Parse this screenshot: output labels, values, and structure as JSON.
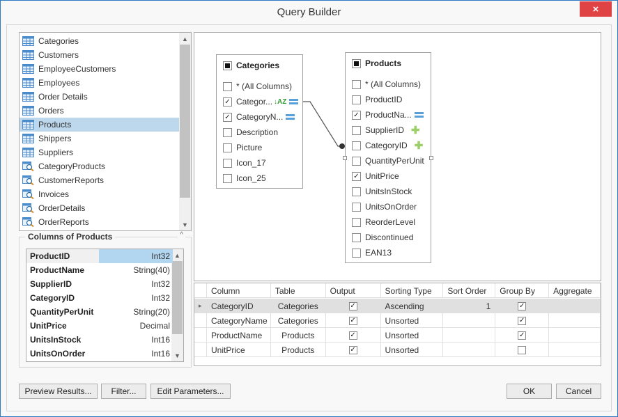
{
  "window": {
    "title": "Query Builder",
    "close_icon": "×"
  },
  "tables_list": {
    "items": [
      {
        "label": "Categories",
        "kind": "table"
      },
      {
        "label": "Customers",
        "kind": "table"
      },
      {
        "label": "EmployeeCustomers",
        "kind": "table"
      },
      {
        "label": "Employees",
        "kind": "table"
      },
      {
        "label": "Order Details",
        "kind": "table"
      },
      {
        "label": "Orders",
        "kind": "table"
      },
      {
        "label": "Products",
        "kind": "table",
        "selected": true
      },
      {
        "label": "Shippers",
        "kind": "table"
      },
      {
        "label": "Suppliers",
        "kind": "table"
      },
      {
        "label": "CategoryProducts",
        "kind": "view"
      },
      {
        "label": "CustomerReports",
        "kind": "view"
      },
      {
        "label": "Invoices",
        "kind": "view"
      },
      {
        "label": "OrderDetails",
        "kind": "view"
      },
      {
        "label": "OrderReports",
        "kind": "view"
      }
    ],
    "scroll_up_icon": "▲",
    "scroll_down_icon": "▼"
  },
  "columns_group": {
    "title": "Columns of Products",
    "collapse_icon": "^",
    "rows": [
      {
        "name": "ProductID",
        "type": "Int32"
      },
      {
        "name": "ProductName",
        "type": "String(40)"
      },
      {
        "name": "SupplierID",
        "type": "Int32"
      },
      {
        "name": "CategoryID",
        "type": "Int32"
      },
      {
        "name": "QuantityPerUnit",
        "type": "String(20)"
      },
      {
        "name": "UnitPrice",
        "type": "Decimal"
      },
      {
        "name": "UnitsInStock",
        "type": "Int16"
      },
      {
        "name": "UnitsOnOrder",
        "type": "Int16"
      }
    ]
  },
  "diagram": {
    "categories": {
      "title": "Categories",
      "columns": [
        {
          "label": "* (All Columns)",
          "checked": false
        },
        {
          "label": "Categor...",
          "checked": true,
          "icons": [
            "sort-az",
            "group"
          ]
        },
        {
          "label": "CategoryN...",
          "checked": true,
          "icons": [
            "group"
          ]
        },
        {
          "label": "Description",
          "checked": false
        },
        {
          "label": "Picture",
          "checked": false
        },
        {
          "label": "Icon_17",
          "checked": false
        },
        {
          "label": "Icon_25",
          "checked": false
        }
      ]
    },
    "products": {
      "title": "Products",
      "columns": [
        {
          "label": "* (All Columns)",
          "checked": false
        },
        {
          "label": "ProductID",
          "checked": false
        },
        {
          "label": "ProductNa...",
          "checked": true,
          "icons": [
            "group"
          ]
        },
        {
          "label": "SupplierID",
          "checked": false,
          "icons": [
            "plus"
          ]
        },
        {
          "label": "CategoryID",
          "checked": false,
          "icons": [
            "plus"
          ]
        },
        {
          "label": "QuantityPerUnit",
          "checked": false
        },
        {
          "label": "UnitPrice",
          "checked": true
        },
        {
          "label": "UnitsInStock",
          "checked": false
        },
        {
          "label": "UnitsOnOrder",
          "checked": false
        },
        {
          "label": "ReorderLevel",
          "checked": false
        },
        {
          "label": "Discontinued",
          "checked": false
        },
        {
          "label": "EAN13",
          "checked": false
        }
      ]
    },
    "check_glyph": "✓",
    "sort_glyph": "↓AZ",
    "plus_glyph": "✚"
  },
  "grid": {
    "headers": [
      "Column",
      "Table",
      "Output",
      "Sorting Type",
      "Sort Order",
      "Group By",
      "Aggregate"
    ],
    "row_indicator": "▸",
    "rows": [
      {
        "column": "CategoryID",
        "table": "Categories",
        "output": true,
        "sorting_type": "Ascending",
        "sort_order": "1",
        "group_by": true,
        "aggregate": ""
      },
      {
        "column": "CategoryName",
        "table": "Categories",
        "output": true,
        "sorting_type": "Unsorted",
        "sort_order": "",
        "group_by": true,
        "aggregate": ""
      },
      {
        "column": "ProductName",
        "table": "Products",
        "output": true,
        "sorting_type": "Unsorted",
        "sort_order": "",
        "group_by": true,
        "aggregate": ""
      },
      {
        "column": "UnitPrice",
        "table": "Products",
        "output": true,
        "sorting_type": "Unsorted",
        "sort_order": "",
        "group_by": false,
        "aggregate": ""
      }
    ]
  },
  "buttons": {
    "preview": "Preview Results...",
    "filter": "Filter...",
    "edit_params": "Edit Parameters...",
    "ok": "OK",
    "cancel": "Cancel"
  }
}
